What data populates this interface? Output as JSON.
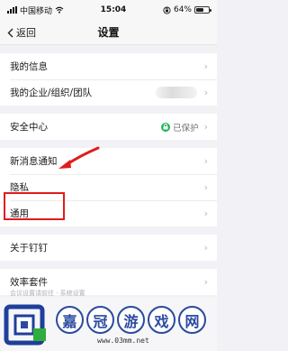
{
  "status": {
    "carrier": "中国移动",
    "time": "15:04",
    "battery": "64%",
    "battery_level": 0.64
  },
  "nav": {
    "back_label": "返回",
    "title": "设置"
  },
  "groups": [
    {
      "rows": [
        {
          "label": "我的信息"
        },
        {
          "label": "我的企业/组织/团队"
        }
      ]
    },
    {
      "rows": [
        {
          "label": "安全中心",
          "value": "已保护"
        }
      ]
    },
    {
      "rows": [
        {
          "label": "新消息通知"
        },
        {
          "label": "隐私"
        },
        {
          "label": "通用"
        }
      ]
    },
    {
      "rows": [
        {
          "label": "关于钉钉"
        }
      ]
    },
    {
      "rows": [
        {
          "label": "效率套件"
        }
      ]
    }
  ],
  "footer_hint": "会议设置请前往 · 系统设置",
  "watermark": {
    "chars": [
      "嘉",
      "冠",
      "游",
      "戏",
      "网"
    ],
    "url": "www.03mm.net"
  },
  "colors": {
    "accent_green": "#1fb35a",
    "highlight_red": "#e11b1b",
    "watermark_blue": "#2b4aa0"
  }
}
